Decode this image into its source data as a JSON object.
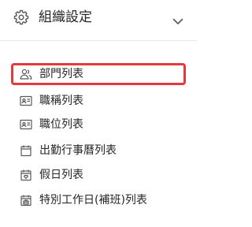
{
  "header": {
    "icon": "gear-icon",
    "title": "組織設定",
    "toggle_icon": "chevron-down-icon"
  },
  "menu": {
    "items": [
      {
        "label": "部門列表",
        "icon": "user-group-icon",
        "selected": true
      },
      {
        "label": "職稱列表",
        "icon": "id-card-icon",
        "selected": false
      },
      {
        "label": "職位列表",
        "icon": "id-card-icon",
        "selected": false
      },
      {
        "label": "出勤行事曆列表",
        "icon": "calendar-icon",
        "selected": false
      },
      {
        "label": "假日列表",
        "icon": "calendar-heart-icon",
        "selected": false
      },
      {
        "label": "特別工作日(補班)列表",
        "icon": "calendar-briefcase-icon",
        "selected": false
      }
    ]
  },
  "colors": {
    "highlight_border": "#e5393f",
    "text": "#262626",
    "icon": "#595959",
    "divider": "#e8e8e8"
  }
}
